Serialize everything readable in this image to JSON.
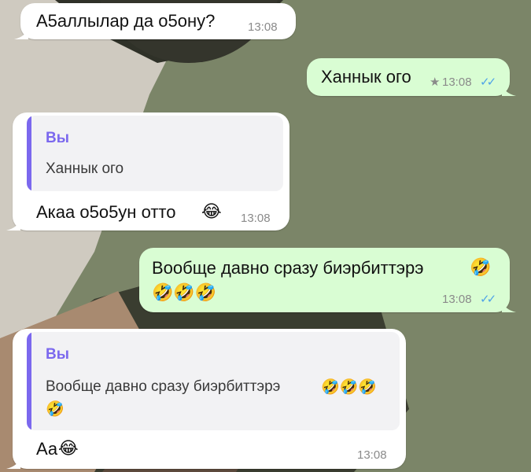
{
  "messages": [
    {
      "text": "А5аллылар да о5ону?",
      "time": "13:08"
    },
    {
      "text": "Ханнык ого",
      "time": "13:08",
      "star": "★",
      "ticks": "✓✓"
    },
    {
      "quote_author": "Вы",
      "quote_text": "Ханнык ого",
      "text": "Акаа о5о5ун отто",
      "emoji": "😂",
      "time": "13:08"
    },
    {
      "text_line1": "Вообще давно сразу биэрбиттэрэ",
      "emoji_line1": "🤣",
      "emoji_line2": "🤣🤣🤣",
      "time": "13:08",
      "ticks": "✓✓"
    },
    {
      "quote_author": "Вы",
      "quote_line1": "Вообще давно сразу биэрбиттэрэ",
      "quote_emoji1": "🤣🤣🤣",
      "quote_emoji2": "🤣",
      "text": "Аа",
      "emoji": "😂",
      "time": "13:08"
    }
  ],
  "colors": {
    "incoming": "#ffffff",
    "outgoing": "#d9fdd3",
    "quote_accent": "#7b68ee",
    "read_ticks": "#4fa3e8"
  }
}
